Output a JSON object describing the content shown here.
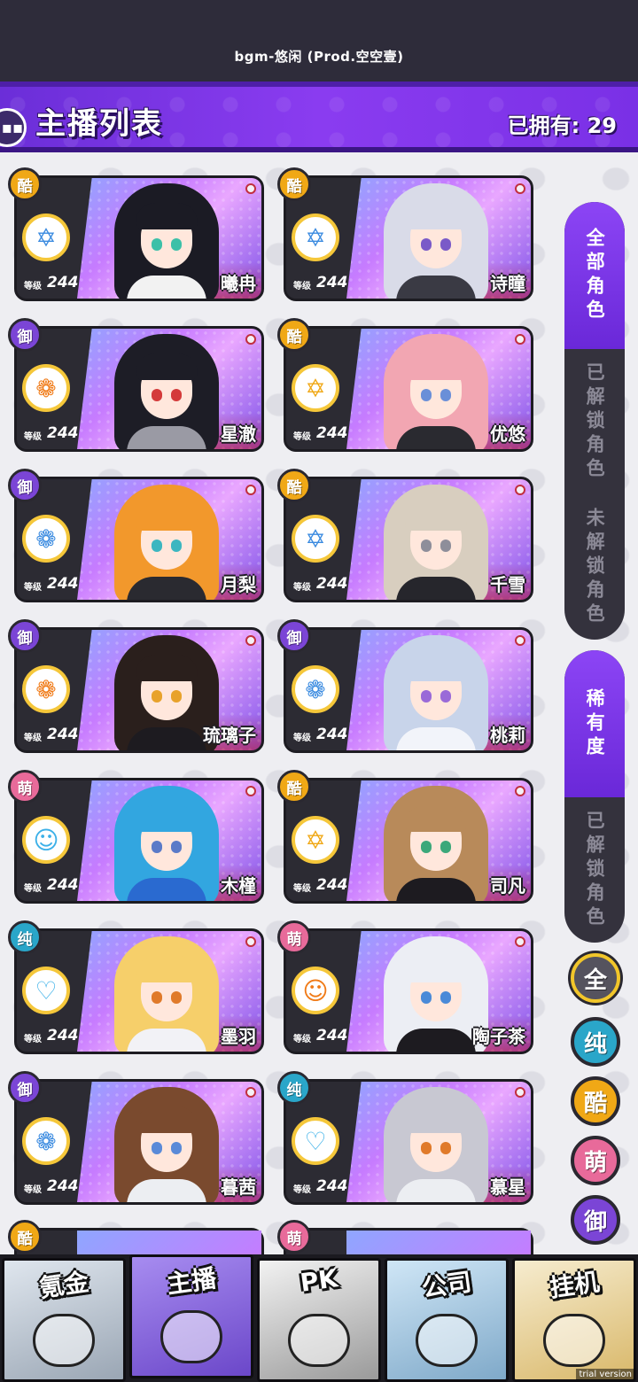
{
  "top_bar": {
    "music_title": "bgm-悠闲 (Prod.空空壹)"
  },
  "header": {
    "title": "主播列表",
    "owned_label": "已拥有:",
    "owned_count": "29"
  },
  "level_label": "等级",
  "cards": [
    {
      "type": "酷",
      "type_class": "type-cool",
      "skill_icon": "star-icon",
      "skill_glyph": "✡",
      "skill_color": "#3b8be0",
      "level": "244",
      "name": "曦冉",
      "hair": "#1b1b24",
      "eye": "#3cc0a8",
      "cloth": "#f2f2f2"
    },
    {
      "type": "酷",
      "type_class": "type-cool",
      "skill_icon": "star-icon",
      "skill_glyph": "✡",
      "skill_color": "#3b8be0",
      "level": "244",
      "name": "诗瞳",
      "hair": "#d9dbe8",
      "eye": "#7a5ac8",
      "cloth": "#3a3a44"
    },
    {
      "type": "御",
      "type_class": "type-royal",
      "skill_icon": "rose-icon",
      "skill_glyph": "❁",
      "skill_color": "#f07a16",
      "level": "244",
      "name": "星澈",
      "hair": "#1d1d26",
      "eye": "#d43a3a",
      "cloth": "#9a9aa4"
    },
    {
      "type": "酷",
      "type_class": "type-cool",
      "skill_icon": "star-icon",
      "skill_glyph": "✡",
      "skill_color": "#f0a816",
      "level": "244",
      "name": "优悠",
      "hair": "#f2a6b2",
      "eye": "#6a8fd8",
      "cloth": "#2a2a30"
    },
    {
      "type": "御",
      "type_class": "type-royal",
      "skill_icon": "rose-icon",
      "skill_glyph": "❁",
      "skill_color": "#3b8be0",
      "level": "244",
      "name": "月梨",
      "hair": "#f2982c",
      "eye": "#3cb6c0",
      "cloth": "#2a2a30"
    },
    {
      "type": "酷",
      "type_class": "type-cool",
      "skill_icon": "star-icon",
      "skill_glyph": "✡",
      "skill_color": "#3b8be0",
      "level": "244",
      "name": "千雪",
      "hair": "#d8cebf",
      "eye": "#8e8e9a",
      "cloth": "#26262c"
    },
    {
      "type": "御",
      "type_class": "type-royal",
      "skill_icon": "rose-icon",
      "skill_glyph": "❁",
      "skill_color": "#f07a16",
      "level": "244",
      "name": "琉璃子",
      "hair": "#2a1f1c",
      "eye": "#e8a22a",
      "cloth": "#1d1b20"
    },
    {
      "type": "御",
      "type_class": "type-royal",
      "skill_icon": "rose-icon",
      "skill_glyph": "❁",
      "skill_color": "#3b8be0",
      "level": "244",
      "name": "桃莉",
      "hair": "#c8d4ea",
      "eye": "#9a6ad8",
      "cloth": "#f2f4fa"
    },
    {
      "type": "萌",
      "type_class": "type-cute",
      "skill_icon": "cat-icon",
      "skill_glyph": "☺",
      "skill_color": "#3bb0e8",
      "level": "244",
      "name": "木槿",
      "hair": "#32a6e0",
      "eye": "#5a7ac8",
      "cloth": "#2a6ad0"
    },
    {
      "type": "酷",
      "type_class": "type-cool",
      "skill_icon": "star-icon",
      "skill_glyph": "✡",
      "skill_color": "#f0a816",
      "level": "244",
      "name": "司凡",
      "hair": "#b88a5a",
      "eye": "#3ca87a",
      "cloth": "#1d1b20"
    },
    {
      "type": "纯",
      "type_class": "type-pure",
      "skill_icon": "heartbeat-icon",
      "skill_glyph": "♡",
      "skill_color": "#3bb0e8",
      "level": "244",
      "name": "墨羽",
      "hair": "#f6cf6a",
      "eye": "#e07a2a",
      "cloth": "#f2f2f6"
    },
    {
      "type": "萌",
      "type_class": "type-cute",
      "skill_icon": "cat-icon",
      "skill_glyph": "☺",
      "skill_color": "#f07a16",
      "level": "244",
      "name": "陶子茶",
      "hair": "#eceef4",
      "eye": "#4a8ad8",
      "cloth": "#1d1b20"
    },
    {
      "type": "御",
      "type_class": "type-royal",
      "skill_icon": "rose-icon",
      "skill_glyph": "❁",
      "skill_color": "#3b8be0",
      "level": "244",
      "name": "暮茜",
      "hair": "#7a4a2e",
      "eye": "#5a8ad8",
      "cloth": "#eceef2"
    },
    {
      "type": "纯",
      "type_class": "type-pure",
      "skill_icon": "heartbeat-icon",
      "skill_glyph": "♡",
      "skill_color": "#3bb0e8",
      "level": "244",
      "name": "慕星",
      "hair": "#c8c8d2",
      "eye": "#e07a2a",
      "cloth": "#eceef2"
    }
  ],
  "partial_cards": [
    {
      "type": "酷",
      "type_class": "type-cool"
    },
    {
      "type": "萌",
      "type_class": "type-cute"
    }
  ],
  "side_tabs": {
    "all": "全部角色",
    "unlocked": "已解锁角色",
    "locked": "未解锁角色",
    "rarity": "稀有度",
    "rarity_unlocked": "已解锁角色"
  },
  "rarity_filters": [
    {
      "label": "全",
      "color": "#55535e",
      "text_color": "#fff"
    },
    {
      "label": "纯",
      "color": "#2aa6c9",
      "text_color": "#fff"
    },
    {
      "label": "酷",
      "color": "#f0a816",
      "text_color": "#fff"
    },
    {
      "label": "萌",
      "color": "#e86a9a",
      "text_color": "#fff"
    },
    {
      "label": "御",
      "color": "#7b45d6",
      "text_color": "#fff"
    }
  ],
  "bottom_nav": [
    {
      "label": "氪金",
      "name": "nav-krypton"
    },
    {
      "label": "主播",
      "name": "nav-streamer"
    },
    {
      "label": "PK",
      "name": "nav-pk"
    },
    {
      "label": "公司",
      "name": "nav-company"
    },
    {
      "label": "挂机",
      "name": "nav-idle"
    }
  ],
  "trial": "trial version"
}
